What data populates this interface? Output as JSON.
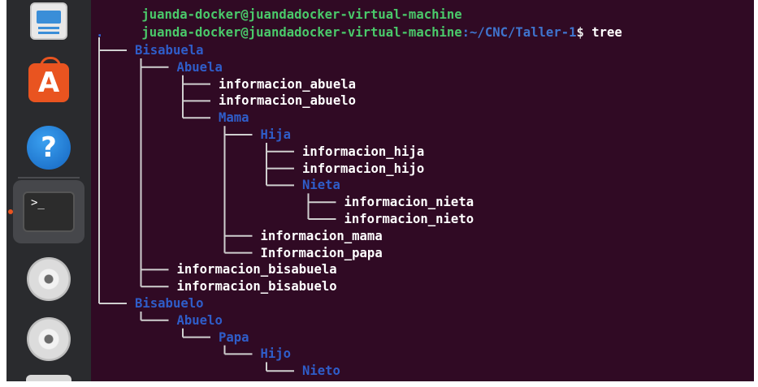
{
  "dock": {
    "items": [
      {
        "name": "files",
        "icon": "files-icon"
      },
      {
        "name": "software",
        "icon": "app-store-icon",
        "glyph": "A"
      },
      {
        "name": "help",
        "icon": "help-icon",
        "glyph": "?"
      },
      {
        "name": "terminal",
        "icon": "terminal-icon",
        "glyph": ">_"
      },
      {
        "name": "disc-1",
        "icon": "disc-icon"
      },
      {
        "name": "disc-2",
        "icon": "disc-icon"
      }
    ]
  },
  "terminal": {
    "prompt_user": "juanda-docker@juandadocker-virtual-machine",
    "prompt_path": ":~/CNC/Taller-1",
    "prompt_dollar": "$",
    "command": "tree",
    "root": ".",
    "tree": [
      {
        "text": "Bisabuela",
        "kind": "dir",
        "depth": 1
      },
      {
        "text": "Abuela",
        "kind": "dir",
        "depth": 2
      },
      {
        "text": "informacion_abuela",
        "kind": "file",
        "depth": 3
      },
      {
        "text": "informacion_abuelo",
        "kind": "file",
        "depth": 3
      },
      {
        "text": "Mama",
        "kind": "dir",
        "depth": 3
      },
      {
        "text": "Hija",
        "kind": "dir",
        "depth": 4
      },
      {
        "text": "informacion_hija",
        "kind": "file",
        "depth": 5
      },
      {
        "text": "informacion_hijo",
        "kind": "file",
        "depth": 5
      },
      {
        "text": "Nieta",
        "kind": "dir",
        "depth": 5
      },
      {
        "text": "informacion_nieta",
        "kind": "file",
        "depth": 6
      },
      {
        "text": "informacion_nieto",
        "kind": "file",
        "depth": 6
      },
      {
        "text": "informacion_mama",
        "kind": "file",
        "depth": 4
      },
      {
        "text": "Informacion_papa",
        "kind": "file",
        "depth": 4
      },
      {
        "text": "informacion_bisabuela",
        "kind": "file",
        "depth": 2
      },
      {
        "text": "informacion_bisabuelo",
        "kind": "file",
        "depth": 2
      },
      {
        "text": "Bisabuelo",
        "kind": "dir",
        "depth": 1
      },
      {
        "text": "Abuelo",
        "kind": "dir",
        "depth": 2
      },
      {
        "text": "Papa",
        "kind": "dir",
        "depth": 3
      },
      {
        "text": "Hijo",
        "kind": "dir",
        "depth": 4
      },
      {
        "text": "Nieto",
        "kind": "dir",
        "depth": 5
      }
    ]
  },
  "colors": {
    "terminal_bg": "#300a24",
    "prompt_user": "#4ac96a",
    "prompt_path": "#3f74ce",
    "directory": "#2f5dc9",
    "file": "#ffffff",
    "running_indicator": "#e95420"
  }
}
